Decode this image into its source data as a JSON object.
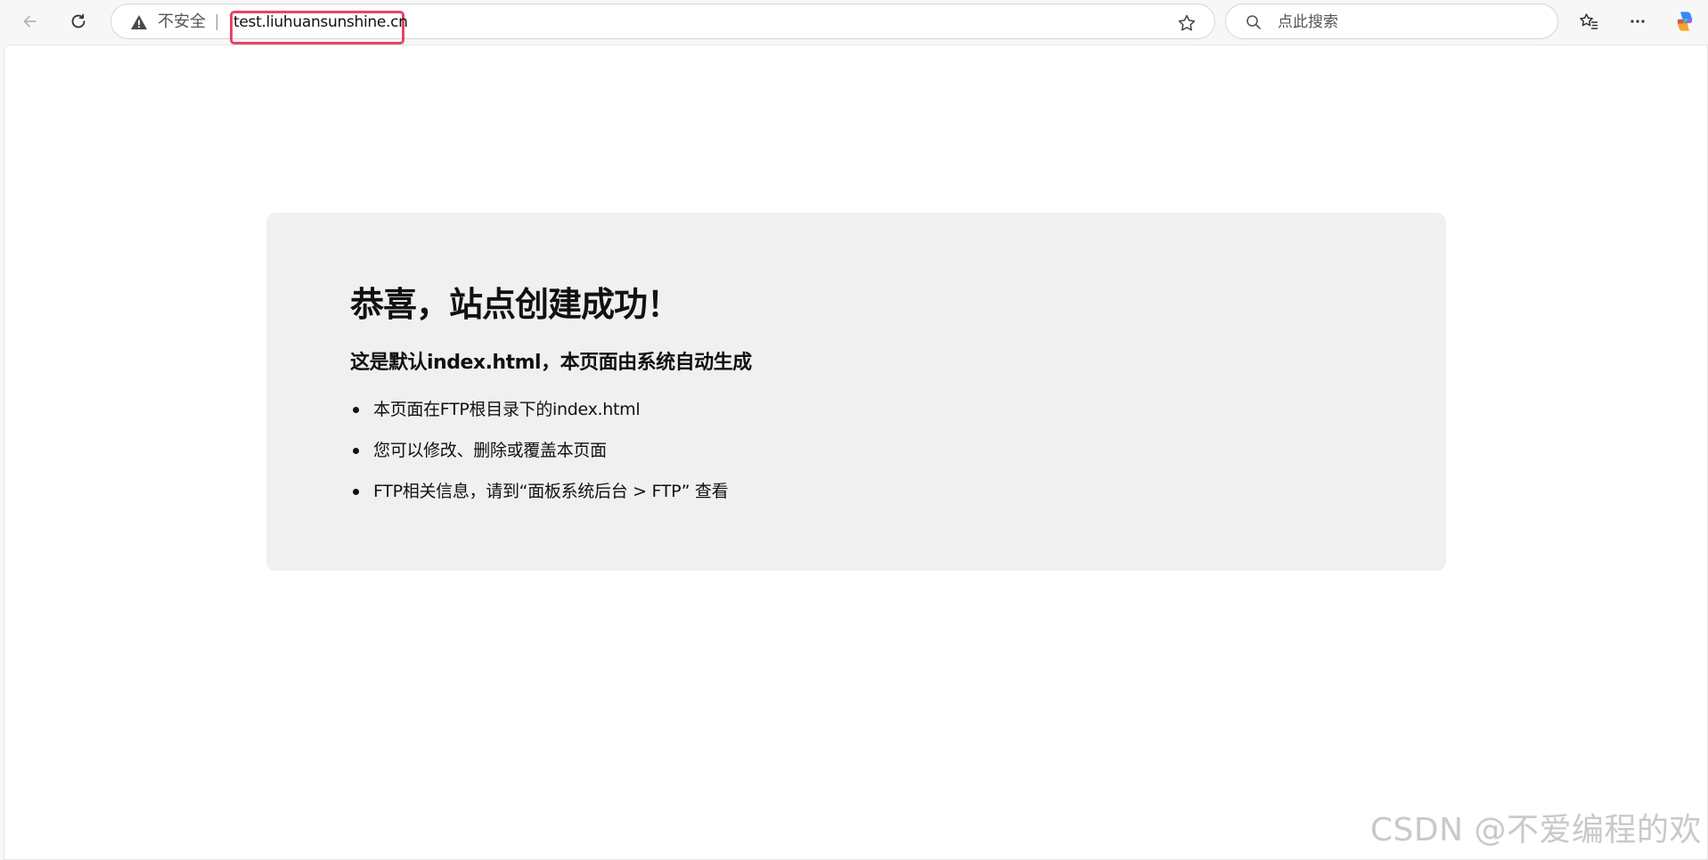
{
  "browser": {
    "security_label": "不安全",
    "url": "test.liuhuansunshine.cn",
    "search_placeholder": "点此搜索"
  },
  "page": {
    "title": "恭喜，站点创建成功！",
    "subtitle": "这是默认index.html，本页面由系统自动生成",
    "items": [
      "本页面在FTP根目录下的index.html",
      "您可以修改、删除或覆盖本页面",
      "FTP相关信息，请到“面板系统后台 > FTP” 查看"
    ]
  },
  "watermark": "CSDN @不爱编程的欢",
  "colors": {
    "highlight": "#e5456a",
    "card_background": "#f0f0f0"
  }
}
